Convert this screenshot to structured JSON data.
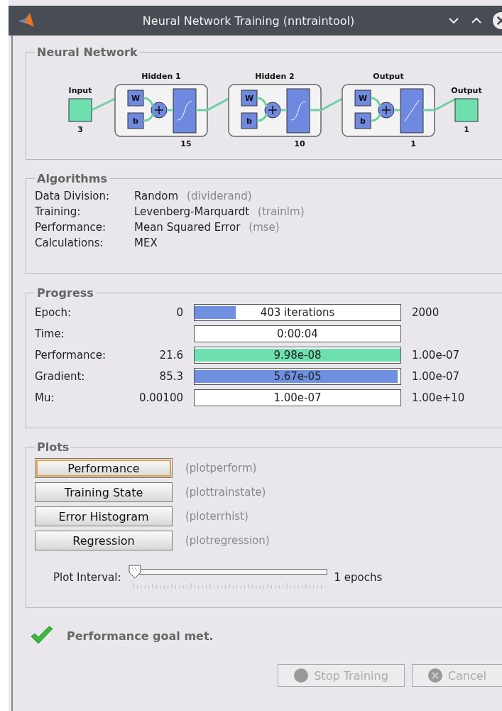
{
  "window": {
    "title": "Neural Network Training (nntraintool)"
  },
  "network": {
    "title": "Neural Network",
    "input": {
      "label": "Input",
      "size": "3"
    },
    "layers": [
      {
        "name": "Hidden 1",
        "size": "15",
        "weight_label": "W",
        "bias_label": "b",
        "kind": "sigmoid"
      },
      {
        "name": "Hidden 2",
        "size": "10",
        "weight_label": "W",
        "bias_label": "b",
        "kind": "sigmoid"
      },
      {
        "name": "Output",
        "size": "1",
        "weight_label": "W",
        "bias_label": "b",
        "kind": "linear"
      }
    ],
    "output": {
      "label": "Output",
      "size": "1"
    }
  },
  "algorithms": {
    "title": "Algorithms",
    "rows": [
      {
        "label": "Data Division:",
        "value": "Random",
        "function": "(dividerand)"
      },
      {
        "label": "Training:",
        "value": "Levenberg-Marquardt",
        "function": "(trainlm)"
      },
      {
        "label": "Performance:",
        "value": "Mean Squared Error",
        "function": "(mse)"
      },
      {
        "label": "Calculations:",
        "value": "MEX"
      }
    ]
  },
  "progress": {
    "title": "Progress",
    "rows": [
      {
        "label": "Epoch:",
        "start": "0",
        "reading": "403 iterations",
        "level": 0.2,
        "color": "#6f8fe0",
        "end": "2000"
      },
      {
        "label": "Time:",
        "reading": "0:00:04"
      },
      {
        "label": "Performance:",
        "start": "21.6",
        "reading": "9.98e-08",
        "level": 1,
        "color": "#6ee0b0",
        "end": "1.00e-07"
      },
      {
        "label": "Gradient:",
        "start": "85.3",
        "reading": "5.67e-05",
        "level": 0.985,
        "color": "#6f8fe0",
        "end": "1.00e-07"
      },
      {
        "label": "Mu:",
        "start": "0.00100",
        "reading": "1.00e-07",
        "end": "1.00e+10"
      }
    ]
  },
  "plots": {
    "title": "Plots",
    "buttons": [
      {
        "label": "Performance",
        "function": "(plotperform)",
        "focused": true
      },
      {
        "label": "Training State",
        "function": "(plottrainstate)",
        "focused": false
      },
      {
        "label": "Error Histogram",
        "function": "(ploterrhist)",
        "focused": false
      },
      {
        "label": "Regression",
        "function": "(plotregression)",
        "focused": false
      }
    ],
    "interval": {
      "label": "Plot Interval:",
      "level": 0,
      "reading": "1 epochs"
    }
  },
  "status": {
    "message": "Performance goal met."
  },
  "buttons": [
    {
      "label": "Stop Training",
      "disabled": true,
      "kind": "stop"
    },
    {
      "label": "Cancel",
      "disabled": true,
      "kind": "cancel"
    }
  ]
}
